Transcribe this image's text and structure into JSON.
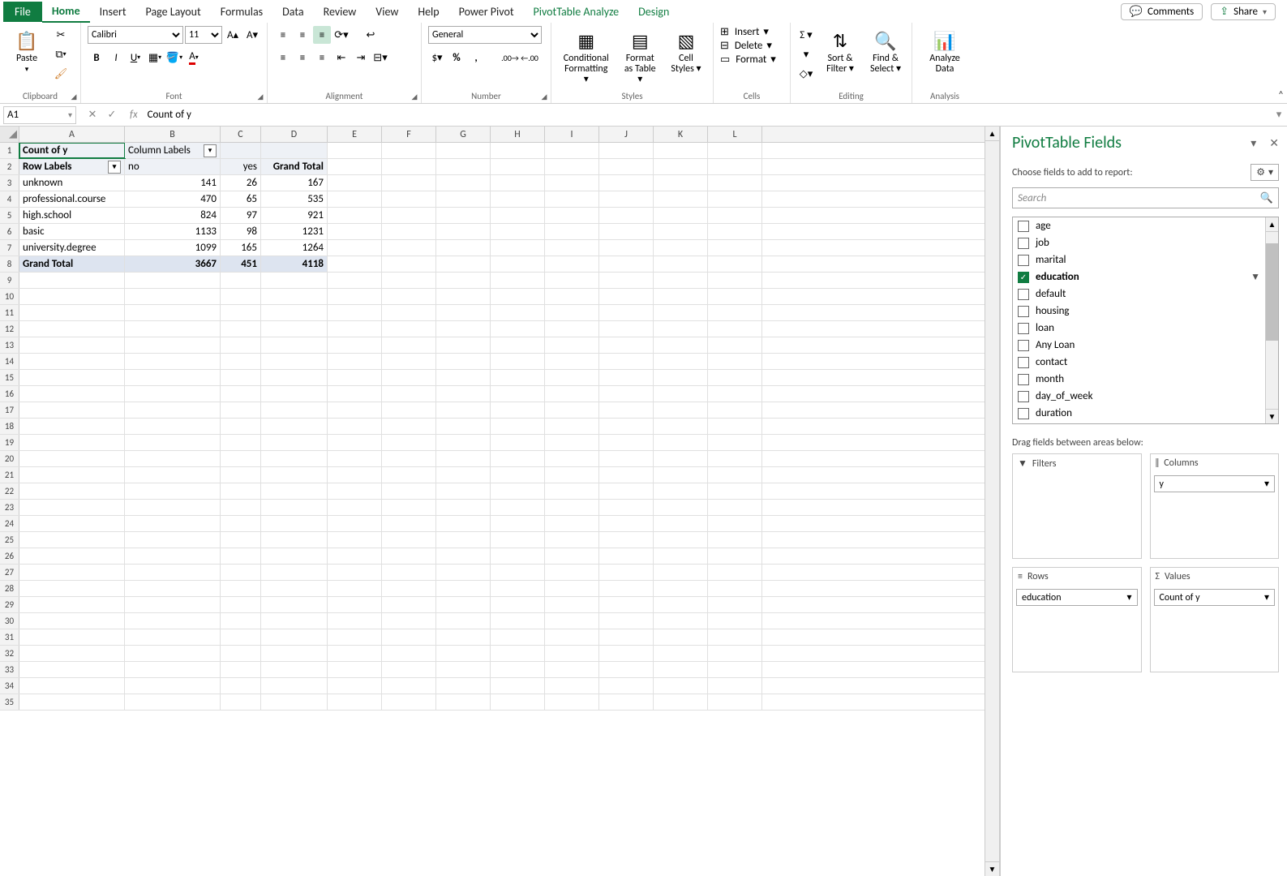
{
  "tabs": {
    "file": "File",
    "home": "Home",
    "insert": "Insert",
    "pageLayout": "Page Layout",
    "formulas": "Formulas",
    "data": "Data",
    "review": "Review",
    "view": "View",
    "help": "Help",
    "powerPivot": "Power Pivot",
    "ptAnalyze": "PivotTable Analyze",
    "design": "Design"
  },
  "share": {
    "comments": "Comments",
    "share": "Share"
  },
  "ribbon": {
    "clipboard": {
      "paste": "Paste",
      "label": "Clipboard"
    },
    "font": {
      "name": "Calibri",
      "size": "11",
      "label": "Font"
    },
    "alignment": {
      "label": "Alignment"
    },
    "number": {
      "format": "General",
      "label": "Number"
    },
    "styles": {
      "cond": "Conditional Formatting",
      "fat": "Format as Table",
      "cell": "Cell Styles",
      "label": "Styles"
    },
    "cells": {
      "insert": "Insert",
      "delete": "Delete",
      "format": "Format",
      "label": "Cells"
    },
    "editing": {
      "sort": "Sort & Filter",
      "find": "Find & Select",
      "label": "Editing"
    },
    "analysis": {
      "analyze": "Analyze Data",
      "label": "Analysis"
    }
  },
  "formulaBar": {
    "ref": "A1",
    "value": "Count of y"
  },
  "chart_data": {
    "type": "table",
    "title": "Count of y",
    "row_field": "education",
    "column_field": "y",
    "columns": [
      "no",
      "yes",
      "Grand Total"
    ],
    "rows": [
      {
        "label": "unknown",
        "values": [
          141,
          26,
          167
        ]
      },
      {
        "label": "professional.course",
        "values": [
          470,
          65,
          535
        ]
      },
      {
        "label": "high.school",
        "values": [
          824,
          97,
          921
        ]
      },
      {
        "label": "basic",
        "values": [
          1133,
          98,
          1231
        ]
      },
      {
        "label": "university.degree",
        "values": [
          1099,
          165,
          1264
        ]
      }
    ],
    "grand_total": {
      "label": "Grand Total",
      "values": [
        3667,
        451,
        4118
      ]
    }
  },
  "pt": {
    "a1": "Count of y",
    "b1": "Column Labels",
    "a2": "Row Labels",
    "b2": "no",
    "c2": "yes",
    "d2": "Grand Total",
    "r3a": "unknown",
    "r3b": "141",
    "r3c": "26",
    "r3d": "167",
    "r4a": "professional.course",
    "r4b": "470",
    "r4c": "65",
    "r4d": "535",
    "r5a": "high.school",
    "r5b": "824",
    "r5c": "97",
    "r5d": "921",
    "r6a": "basic",
    "r6b": "1133",
    "r6c": "98",
    "r6d": "1231",
    "r7a": "university.degree",
    "r7b": "1099",
    "r7c": "165",
    "r7d": "1264",
    "r8a": "Grand Total",
    "r8b": "3667",
    "r8c": "451",
    "r8d": "4118"
  },
  "columns": [
    "A",
    "B",
    "C",
    "D",
    "E",
    "F",
    "G",
    "H",
    "I",
    "J",
    "K",
    "L"
  ],
  "pane": {
    "title": "PivotTable Fields",
    "choose": "Choose fields to add to report:",
    "search": "Search",
    "drag": "Drag fields between areas below:",
    "filters": "Filters",
    "columns": "Columns",
    "rows": "Rows",
    "values": "Values",
    "chipY": "y",
    "chipEdu": "education",
    "chipCount": "Count of y",
    "fields": [
      {
        "name": "age",
        "checked": false
      },
      {
        "name": "job",
        "checked": false
      },
      {
        "name": "marital",
        "checked": false
      },
      {
        "name": "education",
        "checked": true,
        "filter": true
      },
      {
        "name": "default",
        "checked": false
      },
      {
        "name": "housing",
        "checked": false
      },
      {
        "name": "loan",
        "checked": false
      },
      {
        "name": "Any Loan",
        "checked": false
      },
      {
        "name": "contact",
        "checked": false
      },
      {
        "name": "month",
        "checked": false
      },
      {
        "name": "day_of_week",
        "checked": false
      },
      {
        "name": "duration",
        "checked": false
      }
    ]
  }
}
